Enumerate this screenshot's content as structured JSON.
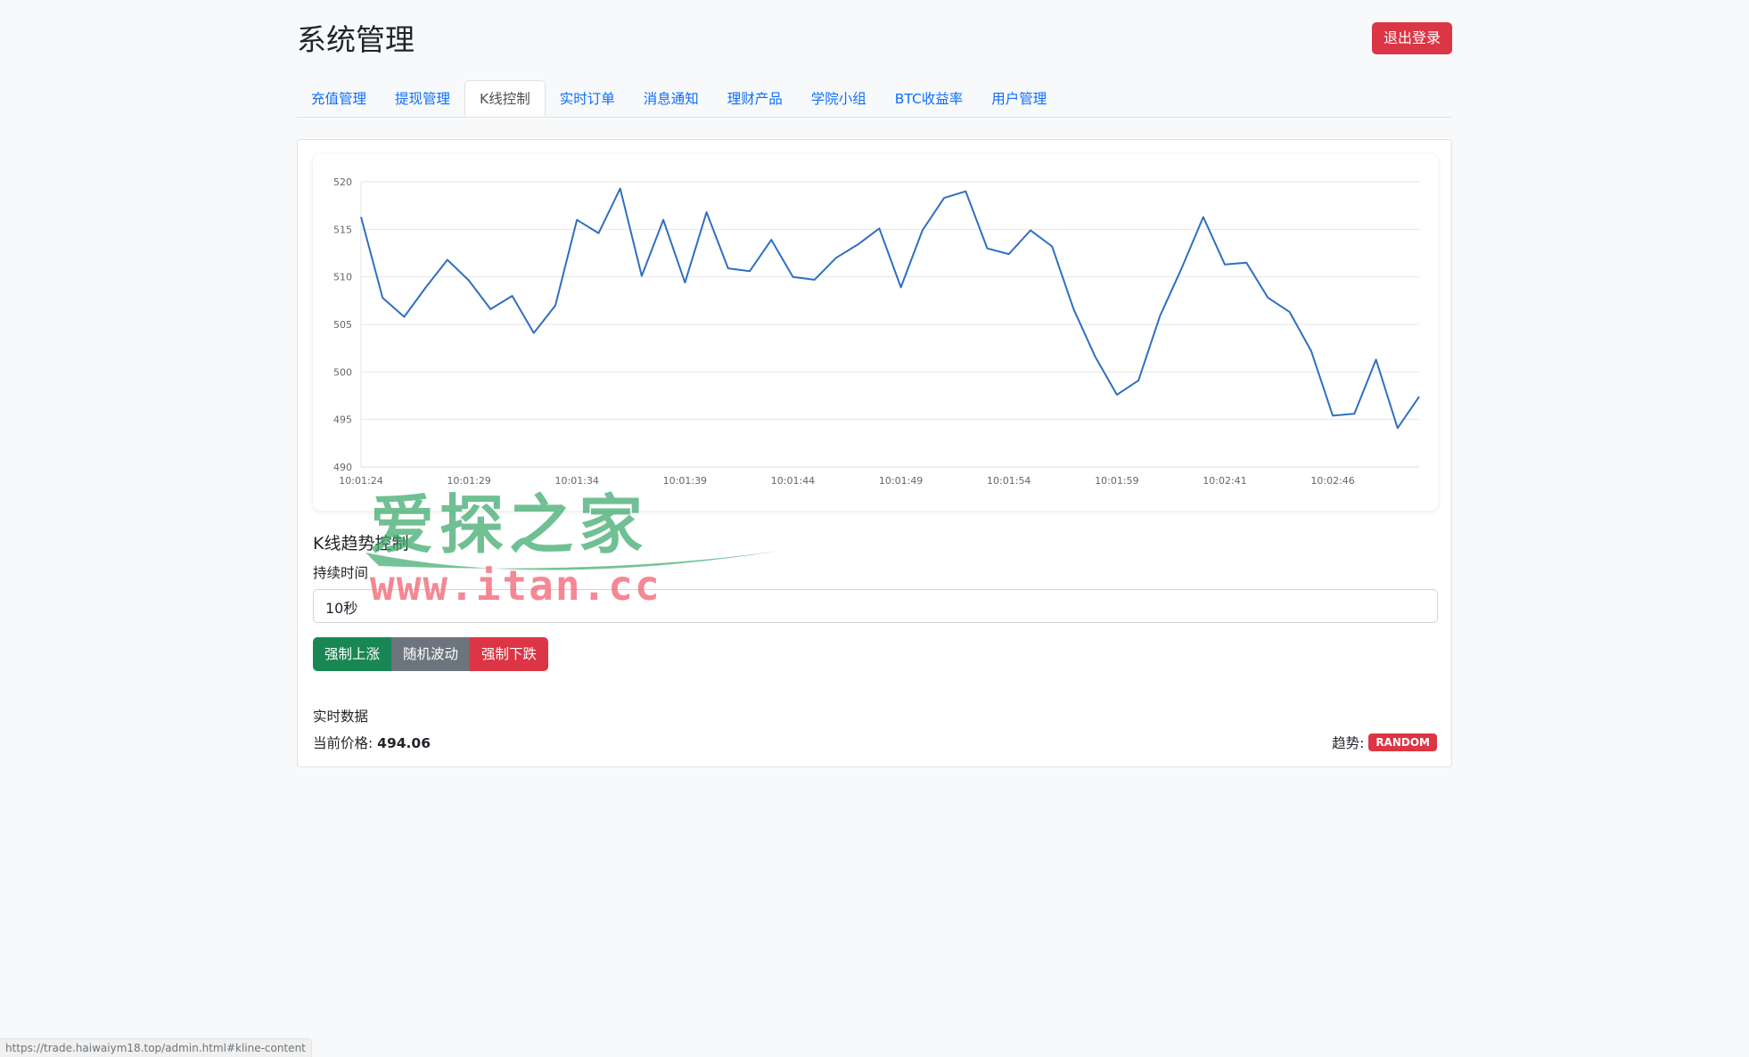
{
  "header": {
    "title": "系统管理",
    "logout_label": "退出登录"
  },
  "tabs": [
    {
      "label": "充值管理",
      "active": false
    },
    {
      "label": "提现管理",
      "active": false
    },
    {
      "label": "K线控制",
      "active": true
    },
    {
      "label": "实时订单",
      "active": false
    },
    {
      "label": "消息通知",
      "active": false
    },
    {
      "label": "理财产品",
      "active": false
    },
    {
      "label": "学院小组",
      "active": false
    },
    {
      "label": "BTC收益率",
      "active": false
    },
    {
      "label": "用户管理",
      "active": false
    }
  ],
  "chart_data": {
    "type": "line",
    "x_tick_labels": [
      "10:01:24",
      "10:01:29",
      "10:01:34",
      "10:01:39",
      "10:01:44",
      "10:01:49",
      "10:01:54",
      "10:01:59",
      "10:02:41",
      "10:02:46"
    ],
    "y_ticks": [
      490,
      495,
      500,
      505,
      510,
      515,
      520
    ],
    "ylim": [
      490,
      520
    ],
    "grid": true,
    "color": "#2f6fc2",
    "values": [
      516.3,
      507.8,
      505.8,
      508.9,
      511.8,
      509.6,
      506.6,
      508.0,
      504.1,
      507.0,
      516.0,
      514.6,
      519.3,
      510.1,
      516.0,
      509.4,
      516.8,
      510.9,
      510.6,
      513.9,
      510.0,
      509.7,
      512.0,
      513.4,
      515.1,
      508.9,
      514.9,
      518.3,
      519.0,
      513.0,
      512.4,
      514.9,
      513.2,
      506.6,
      501.6,
      497.6,
      499.1,
      505.9,
      510.9,
      516.3,
      511.3,
      511.5,
      507.8,
      506.3,
      502.2,
      495.4,
      495.6,
      501.3,
      494.1,
      497.4
    ]
  },
  "control": {
    "section_title": "K线趋势控制",
    "duration_label": "持续时间",
    "duration_value": "10秒",
    "buttons": {
      "up": "强制上涨",
      "random": "随机波动",
      "down": "强制下跌"
    }
  },
  "realtime": {
    "title": "实时数据",
    "price_label": "当前价格:",
    "price_value": "494.06",
    "trend_label": "趋势:",
    "trend_value": "RANDOM"
  },
  "watermark": {
    "text_cn": "爱探之家",
    "url": "www.itan.cc"
  },
  "statusbar": {
    "url": "https://trade.haiwaiym18.top/admin.html#kline-content"
  },
  "colors": {
    "accent": "#0d6efd",
    "danger": "#dc3545",
    "success": "#198754",
    "secondary": "#6c757d"
  }
}
